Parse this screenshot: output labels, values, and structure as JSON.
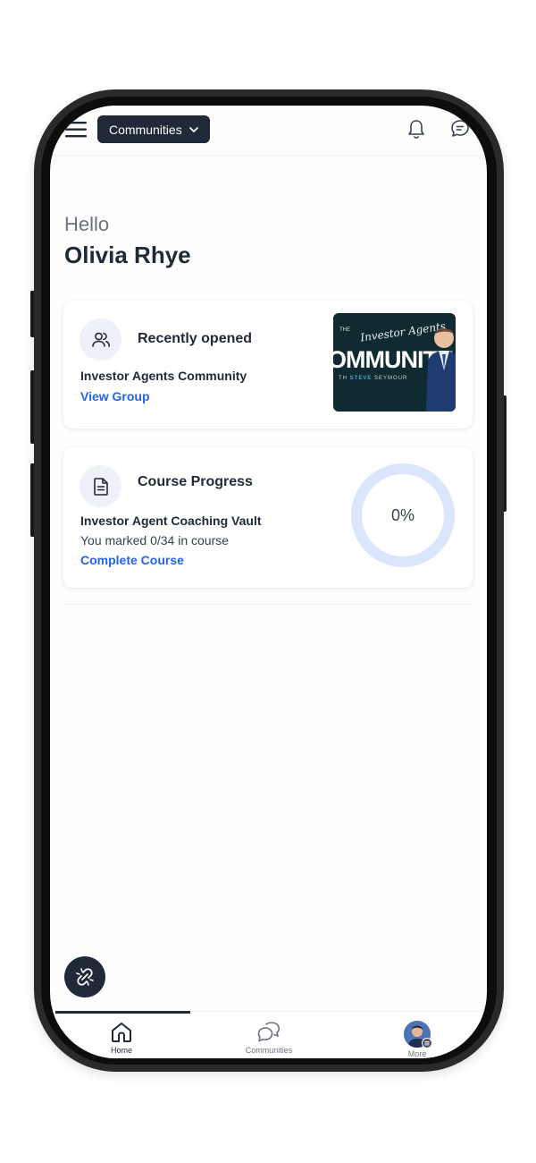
{
  "header": {
    "dropdown_label": "Communities",
    "icons": {
      "menu": "hamburger-icon",
      "dropdown": "chevron-down-icon",
      "notifications": "bell-icon",
      "messages": "chat-icon"
    }
  },
  "greeting": {
    "hello": "Hello",
    "name": "Olivia Rhye"
  },
  "recently_opened": {
    "title": "Recently opened",
    "icon": "users-icon",
    "item_name": "Investor Agents Community",
    "link": "View Group",
    "thumbnail": {
      "top_text": "THE",
      "script_text": "Investor Agents",
      "big_text": "OMMUNITY",
      "bottom_prefix": "TH",
      "bottom_highlight": "STEVE",
      "bottom_suffix": "SEYMOUR"
    }
  },
  "course_progress": {
    "title": "Course Progress",
    "icon": "document-icon",
    "course_name": "Investor Agent Coaching Vault",
    "detail": "You marked 0/34 in course",
    "link": "Complete Course",
    "percent_label": "0%",
    "progress": 0
  },
  "fab": {
    "icon": "link-off-icon"
  },
  "bottom_nav": {
    "items": [
      {
        "label": "Home",
        "icon": "home-icon",
        "active": true
      },
      {
        "label": "Communities",
        "icon": "chat-bubbles-icon",
        "active": false
      },
      {
        "label": "More",
        "icon": "avatar",
        "active": false
      }
    ]
  },
  "colors": {
    "primary_dark": "#1f2937",
    "link_blue": "#2563eb",
    "ring_track": "#dbe5fb",
    "muted_text": "#6b7280"
  }
}
